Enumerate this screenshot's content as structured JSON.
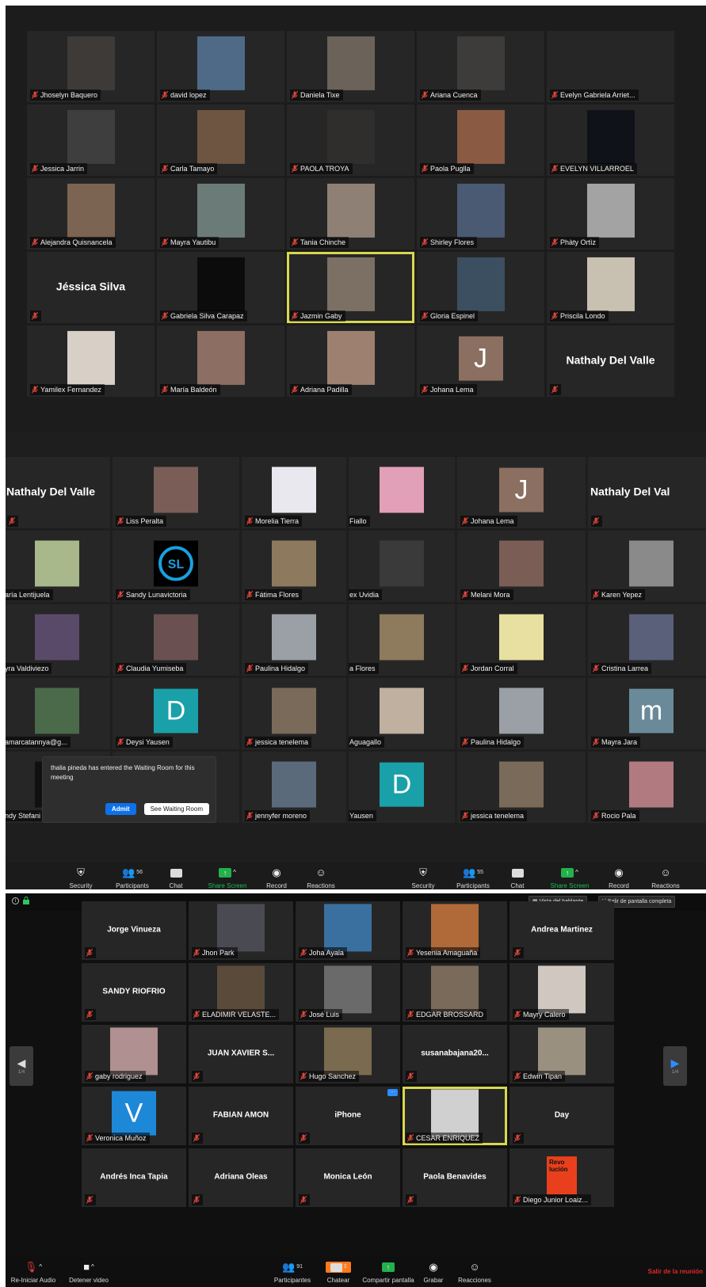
{
  "panel1": {
    "tiles": [
      {
        "name": "Jhoselyn Baquero",
        "kind": "photo",
        "bg": "#3d3a38"
      },
      {
        "name": "david lopez",
        "kind": "photo",
        "bg": "#4f6a87"
      },
      {
        "name": "Daniela Tixe",
        "kind": "photo",
        "bg": "#6b6259"
      },
      {
        "name": "Ariana Cuenca",
        "kind": "photo",
        "bg": "#3d3c3a"
      },
      {
        "name": "Evelyn Gabriela Arriet...",
        "kind": "blank"
      },
      {
        "name": "Jessica Jarrin",
        "kind": "photo",
        "bg": "#3e3e3e"
      },
      {
        "name": "Carla Tamayo",
        "kind": "photo",
        "bg": "#6d5541"
      },
      {
        "name": "PAOLA TROYA",
        "kind": "photo",
        "bg": "#2f2e2d"
      },
      {
        "name": "Paola Puglla",
        "kind": "photo",
        "bg": "#8a5a42"
      },
      {
        "name": "EVELYN VILLARROEL",
        "kind": "photo",
        "bg": "#0f1219"
      },
      {
        "name": "Alejandra Quisnancela",
        "kind": "photo",
        "bg": "#7b6452"
      },
      {
        "name": "Mayra Yautibu",
        "kind": "photo",
        "bg": "#6b7c78"
      },
      {
        "name": "Tania Chinche",
        "kind": "photo",
        "bg": "#8e8074"
      },
      {
        "name": "Shirley Flores",
        "kind": "photo",
        "bg": "#4a5a73"
      },
      {
        "name": "Phàty Ortìz",
        "kind": "photo",
        "bg": "#a3a3a3"
      },
      {
        "name": "",
        "kind": "name",
        "big": "Jéssica Silva"
      },
      {
        "name": "Gabriela Silva Carapaz",
        "kind": "photo",
        "bg": "#0c0c0c"
      },
      {
        "name": "Jazmin Gaby",
        "kind": "photo",
        "bg": "#7c6f64",
        "active": true
      },
      {
        "name": "Gloria Espinel",
        "kind": "photo",
        "bg": "#3c4f60"
      },
      {
        "name": "Priscila Londo",
        "kind": "photo",
        "bg": "#c8c0b0"
      },
      {
        "name": "Yamilex Fernandez",
        "kind": "photo",
        "bg": "#d8cfc7"
      },
      {
        "name": "María Baldeón",
        "kind": "photo",
        "bg": "#8d6e63"
      },
      {
        "name": "Adriana Padilla",
        "kind": "photo",
        "bg": "#9e8070"
      },
      {
        "name": "Johana Lema",
        "kind": "letter",
        "letter": "J",
        "bg": "#8b6f60"
      },
      {
        "name": "",
        "kind": "name",
        "big": "Nathaly Del Valle"
      }
    ]
  },
  "panel2": {
    "tiles": [
      {
        "name": "",
        "kind": "name",
        "big": "Nathaly Del Valle",
        "left": true
      },
      {
        "name": "Liss Peralta",
        "kind": "photo",
        "bg": "#7a5d57"
      },
      {
        "name": "Morelia Tierra",
        "kind": "photo",
        "bg": "#e8e8ee"
      },
      {
        "name": "Fiallo",
        "kind": "photo",
        "bg": "#e2a0b8",
        "neg": true
      },
      {
        "name": "Johana Lema",
        "kind": "letter",
        "letter": "J",
        "bg": "#8b6f60"
      },
      {
        "name": "",
        "kind": "name",
        "big": "Nathaly Del Val",
        "left": true
      },
      {
        "name": "aría Lentijuela",
        "kind": "photo",
        "bg": "#a8b88a",
        "neg": true
      },
      {
        "name": "Sandy Lunavictoria",
        "kind": "logo"
      },
      {
        "name": "Fátima Flores",
        "kind": "photo",
        "bg": "#8d7a5e"
      },
      {
        "name": "ex Uvidia",
        "kind": "photo",
        "bg": "#3a3a3a",
        "neg": true
      },
      {
        "name": "Melani Mora",
        "kind": "photo",
        "bg": "#7a5e55"
      },
      {
        "name": "Karen Yepez",
        "kind": "photo",
        "bg": "#8a8a8a"
      },
      {
        "name": "yra Valdiviezo",
        "kind": "photo",
        "bg": "#5a4a6a",
        "neg": true
      },
      {
        "name": "Claudia Yumiseba",
        "kind": "photo",
        "bg": "#6a5050"
      },
      {
        "name": "Paulina Hidalgo",
        "kind": "photo",
        "bg": "#9aa0a6"
      },
      {
        "name": "a Flores",
        "kind": "photo",
        "bg": "#8e7a5c",
        "neg": true
      },
      {
        "name": "Jordan Corral",
        "kind": "photo",
        "bg": "#e8e0a0"
      },
      {
        "name": "Cristina Larrea",
        "kind": "photo",
        "bg": "#5a5f7a"
      },
      {
        "name": "amarcatannya@g...",
        "kind": "photo",
        "bg": "#4a6a4a",
        "neg": true
      },
      {
        "name": "Deysi Yausen",
        "kind": "letter",
        "letter": "D",
        "bg": "#1aa0a8"
      },
      {
        "name": "jessica tenelema",
        "kind": "photo",
        "bg": "#7a6a5a"
      },
      {
        "name": "Aguagallo",
        "kind": "photo",
        "bg": "#c0b0a0",
        "neg": true
      },
      {
        "name": "Paulina Hidalgo",
        "kind": "photo",
        "bg": "#9aa0a6"
      },
      {
        "name": "Mayra Jara",
        "kind": "letter",
        "letter": "m",
        "bg": "#6a8a9a"
      },
      {
        "name": "ndy Stefani",
        "kind": "photo",
        "bg": "#101010",
        "neg": true
      },
      {
        "name": "",
        "kind": "blank"
      },
      {
        "name": "jennyfer moreno",
        "kind": "photo",
        "bg": "#5a6a7a"
      },
      {
        "name": "Yausen",
        "kind": "letter",
        "letter": "D",
        "bg": "#1aa0a8",
        "neg": true
      },
      {
        "name": "jessica tenelema",
        "kind": "photo",
        "bg": "#7a6a5a"
      },
      {
        "name": "Rocio Pala",
        "kind": "photo",
        "bg": "#b07a80"
      }
    ],
    "waiting": {
      "message": "thalia pineda has entered the Waiting Room for this meeting",
      "admit": "Admit",
      "see": "See Waiting Room"
    },
    "toolbar_left": {
      "security": "Security",
      "participants": "Participants",
      "count": "56",
      "chat": "Chat",
      "share": "Share Screen",
      "record": "Record",
      "reactions": "Reactions"
    },
    "toolbar_right": {
      "security": "Security",
      "participants": "Participants",
      "count": "55",
      "chat": "Chat",
      "share": "Share Screen",
      "record": "Record",
      "reactions": "Reactions"
    }
  },
  "panel3": {
    "speaker_view": "Vista del hablante",
    "exit_fullscreen": "Salir de pantalla completa",
    "page_left": "1/4",
    "page_right": "1/4",
    "tiles": [
      {
        "name": "",
        "kind": "name",
        "big": "Jorge Vinueza"
      },
      {
        "name": "Jhon Park",
        "kind": "photo",
        "bg": "#4a4a52"
      },
      {
        "name": "Joha Ayala",
        "kind": "photo",
        "bg": "#3a70a0"
      },
      {
        "name": "Yesenia Amaguaña",
        "kind": "photo",
        "bg": "#b06a3a"
      },
      {
        "name": "",
        "kind": "name",
        "big": "Andrea Martinez"
      },
      {
        "name": "",
        "kind": "name",
        "big": "SANDY RIOFRIO"
      },
      {
        "name": "ELADIMIR VELASTE...",
        "kind": "photo",
        "bg": "#5a4a3a"
      },
      {
        "name": "José Luis",
        "kind": "photo",
        "bg": "#6a6a6a"
      },
      {
        "name": "EDGAR BROSSARD",
        "kind": "photo",
        "bg": "#7a6a5a"
      },
      {
        "name": "Mayry Calero",
        "kind": "photo",
        "bg": "#d0c8c0"
      },
      {
        "name": "gaby rodriguez",
        "kind": "photo",
        "bg": "#b09090"
      },
      {
        "name": "",
        "kind": "name",
        "big": "JUAN XAVIER S..."
      },
      {
        "name": "Hugo Sanchez",
        "kind": "photo",
        "bg": "#7a6a50"
      },
      {
        "name": "",
        "kind": "name",
        "big": "susanabajana20..."
      },
      {
        "name": "Edwin Tipan",
        "kind": "photo",
        "bg": "#9a9080"
      },
      {
        "name": "Veronica Muñoz",
        "kind": "letter",
        "letter": "V",
        "bg": "#1e88d8"
      },
      {
        "name": "",
        "kind": "name",
        "big": "FABIAN AMON"
      },
      {
        "name": "",
        "kind": "name",
        "big": "iPhone",
        "badge": true
      },
      {
        "name": "CESAR ENRIQUEZ",
        "kind": "photo",
        "bg": "#d0d0d0",
        "active": true
      },
      {
        "name": "",
        "kind": "name",
        "big": "Day"
      },
      {
        "name": "",
        "kind": "name",
        "big": "Andrés Inca Tapia"
      },
      {
        "name": "",
        "kind": "name",
        "big": "Adriana Oleas"
      },
      {
        "name": "",
        "kind": "name",
        "big": "Monica León"
      },
      {
        "name": "",
        "kind": "name",
        "big": "Paola Benavides"
      },
      {
        "name": "Diego Junior Loaiz...",
        "kind": "poster",
        "text": "Revo lución"
      }
    ],
    "toolbar": {
      "audio": "Re-Iniciar Audio",
      "video": "Detener video",
      "participants": "Participantes",
      "count": "91",
      "chat": "Chatear",
      "chat_count": "3",
      "share": "Compartir pantalla",
      "record": "Grabar",
      "reactions": "Reacciones",
      "leave": "Salir de la reunión"
    }
  }
}
